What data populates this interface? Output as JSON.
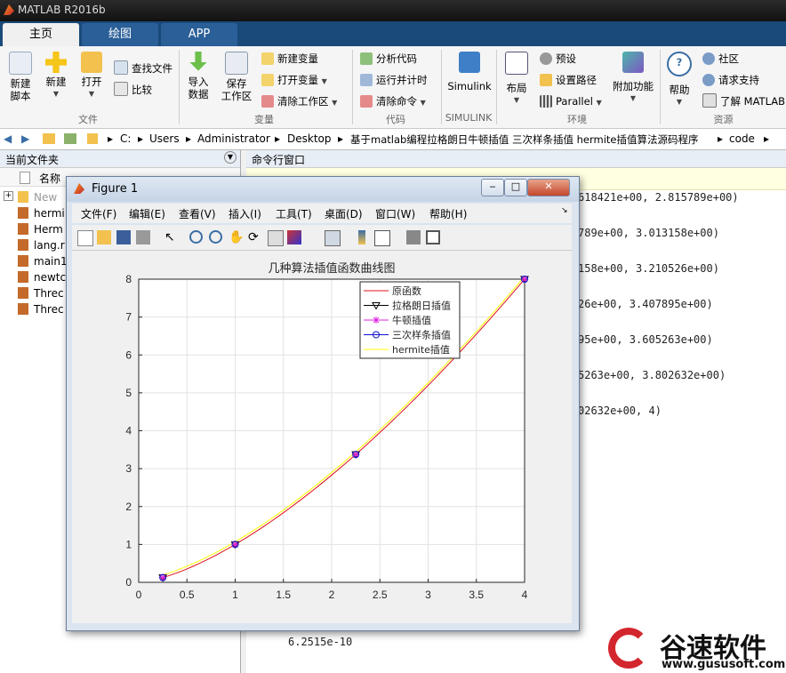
{
  "window": {
    "title": "MATLAB R2016b"
  },
  "tabs": [
    "主页",
    "绘图",
    "APP"
  ],
  "ribbon": {
    "file_group": {
      "new_script": "新建\n脚本",
      "new": "新建",
      "open": "打开",
      "find_files": "查找文件",
      "compare": "比较",
      "label": "文件"
    },
    "variable_group": {
      "import": "导入\n数据",
      "save_ws": "保存\n工作区",
      "new_var": "新建变量",
      "open_var": "打开变量",
      "clear_ws": "清除工作区",
      "label": "变量"
    },
    "code_group": {
      "analyze": "分析代码",
      "run_time": "运行并计时",
      "clear_cmd": "清除命令",
      "label": "代码"
    },
    "simulink_group": {
      "simulink": "Simulink",
      "label": "SIMULINK"
    },
    "env_group": {
      "layout": "布局",
      "prefs": "预设",
      "set_path": "设置路径",
      "parallel": "Parallel",
      "addons": "附加功能",
      "label": "环境"
    },
    "resources_group": {
      "help": "帮助",
      "community": "社区",
      "support": "请求支持",
      "learn": "了解 MATLAB",
      "label": "资源"
    }
  },
  "address": {
    "parts": [
      "C:",
      "Users",
      "Administrator",
      "Desktop",
      "基于matlab编程拉格朗日牛顿插值 三次样条插值 hermite插值算法源码程序",
      "code"
    ]
  },
  "left_panel": {
    "title": "当前文件夹",
    "column": "名称",
    "files": [
      "New",
      "hermi",
      "Herm",
      "lang.r",
      "main1",
      "newtc",
      "Threc",
      "Threc"
    ]
  },
  "command_panel": {
    "title": "命令行窗口",
    "lines": [
      "618421e+00, 2.815789e+00)",
      "789e+00, 3.013158e+00)",
      "158e+00, 3.210526e+00)",
      "26e+00, 3.407895e+00)",
      "95e+00, 3.605263e+00)",
      "5263e+00, 3.802632e+00)",
      "02632e+00, 4)",
      "6.2515e-10"
    ]
  },
  "figure": {
    "title": "Figure 1",
    "menu": [
      "文件(F)",
      "编辑(E)",
      "查看(V)",
      "插入(I)",
      "工具(T)",
      "桌面(D)",
      "窗口(W)",
      "帮助(H)"
    ]
  },
  "chart_data": {
    "type": "line",
    "title": "几种算法插值函数曲线图",
    "xlabel": "",
    "ylabel": "",
    "xlim": [
      0,
      4
    ],
    "ylim": [
      0,
      8
    ],
    "xticks": [
      0,
      0.5,
      1,
      1.5,
      2,
      2.5,
      3,
      3.5,
      4
    ],
    "yticks": [
      0,
      1,
      2,
      3,
      4,
      5,
      6,
      7,
      8
    ],
    "grid": true,
    "legend_position": "top-right",
    "x": [
      0.25,
      1,
      2.25,
      4
    ],
    "series": [
      {
        "name": "原函数",
        "color": "#e0101a",
        "marker": "none",
        "values": [
          0.125,
          1,
          3.375,
          8
        ]
      },
      {
        "name": "拉格朗日插值",
        "color": "#000000",
        "marker": "triangle-down",
        "values": [
          0.125,
          1,
          3.375,
          8
        ]
      },
      {
        "name": "牛顿插值",
        "color": "#e020e0",
        "marker": "star",
        "values": [
          0.125,
          1,
          3.375,
          8
        ]
      },
      {
        "name": "三次样条插值",
        "color": "#1010d0",
        "marker": "circle",
        "values": [
          0.125,
          1,
          3.375,
          8
        ]
      },
      {
        "name": "hermite插值",
        "color": "#ffff00",
        "marker": "none",
        "values": [
          0.125,
          1,
          3.375,
          8
        ]
      }
    ]
  },
  "watermark": {
    "brand": "谷速软件",
    "url": "www.gususoft.com"
  }
}
